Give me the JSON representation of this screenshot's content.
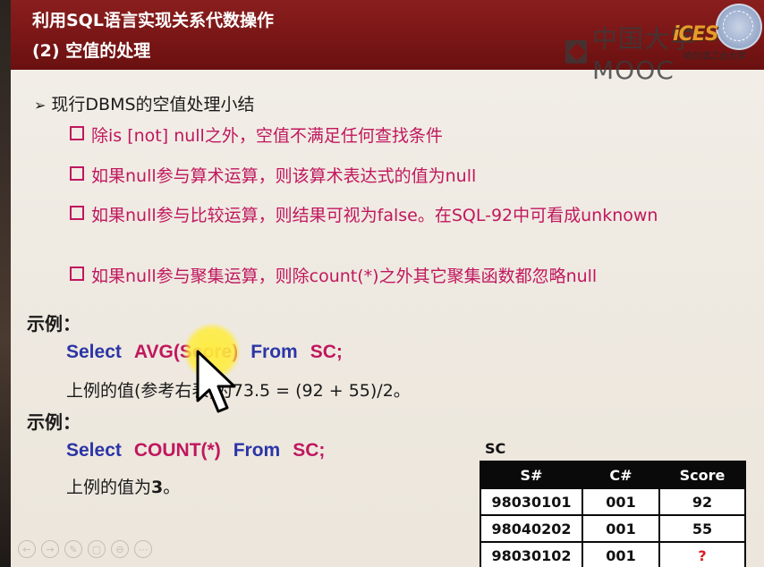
{
  "header": {
    "title_line1": "利用SQL语言实现关系代数操作",
    "title_line2": "(2) 空值的处理",
    "logo_text": "iCES",
    "watermark": "中国大学MOOC",
    "watermark_sub": "哈尔滨工业大学"
  },
  "summary": {
    "arrow": "➢",
    "text": "现行DBMS的空值处理小结"
  },
  "bullets": [
    "除is [not] null之外，空值不满足任何查找条件",
    "如果null参与算术运算，则该算术表达式的值为null",
    "如果null参与比较运算，则结果可视为false。在SQL-92中可看成unknown",
    "如果null参与聚集运算，则除count(*)之外其它聚集函数都忽略null"
  ],
  "example1": {
    "label": "示例：",
    "sql_select": "Select",
    "sql_func": "AVG(Score)",
    "sql_from": "From",
    "sql_table": "SC;",
    "result": "上例的值(参考右表)为73.5 = (92 + 55)/2。"
  },
  "example2": {
    "label": "示例：",
    "sql_select": "Select",
    "sql_func": "COUNT(*)",
    "sql_from": "From",
    "sql_table": "SC;",
    "result_prefix": "上例的值为",
    "result_value": "3",
    "result_suffix": "。"
  },
  "table": {
    "title": "SC",
    "headers": [
      "S#",
      "C#",
      "Score"
    ],
    "rows": [
      [
        "98030101",
        "001",
        "92"
      ],
      [
        "98040202",
        "001",
        "55"
      ],
      [
        "98030102",
        "001",
        "?"
      ]
    ]
  },
  "controls": [
    "←",
    "→",
    "✎",
    "▢",
    "⊖",
    "⋯"
  ],
  "colors": {
    "header": "#7a1616",
    "keyword": "#2b35a6",
    "function": "#c0175e",
    "bullet": "#c0175e",
    "null_marker": "#d81b20"
  }
}
